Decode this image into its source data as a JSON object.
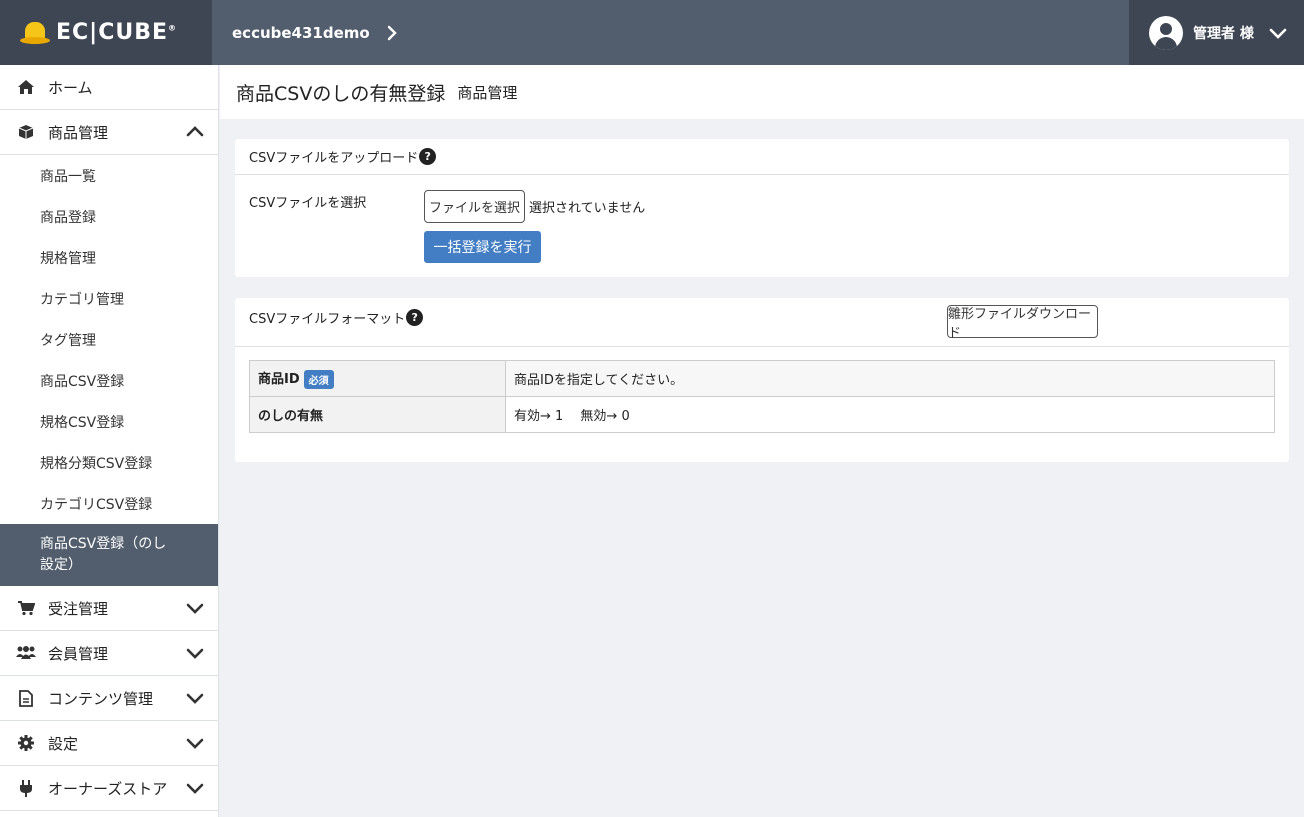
{
  "header": {
    "logo_text": "EC|CUBE",
    "logo_mark": "®",
    "shop_name": "eccube431demo",
    "user_name": "管理者 様"
  },
  "sidebar": {
    "home": "ホーム",
    "product": "商品管理",
    "product_items": [
      "商品一覧",
      "商品登録",
      "規格管理",
      "カテゴリ管理",
      "タグ管理",
      "商品CSV登録",
      "規格CSV登録",
      "規格分類CSV登録",
      "カテゴリCSV登録",
      "商品CSV登録（のし設定）"
    ],
    "order": "受注管理",
    "customer": "会員管理",
    "content": "コンテンツ管理",
    "setting": "設定",
    "owners_store": "オーナーズストア"
  },
  "page": {
    "title": "商品CSVのしの有無登録",
    "subtitle": "商品管理"
  },
  "upload": {
    "heading": "CSVファイルをアップロード",
    "help": "?",
    "select_label": "CSVファイルを選択",
    "file_button": "ファイルを選択",
    "file_status": "選択されていません",
    "exec_button": "一括登録を実行"
  },
  "format": {
    "heading": "CSVファイルフォーマット",
    "help": "?",
    "download_button": "雛形ファイルダウンロード",
    "rows": [
      {
        "key": "商品ID",
        "required": "必須",
        "desc": "商品IDを指定してください。"
      },
      {
        "key": "のしの有無",
        "required": "",
        "desc": "有効→ 1　 無効→ 0"
      }
    ]
  },
  "colors": {
    "header_bg": "#525e6d",
    "header_dark": "#3d4652",
    "accent": "#437ec4",
    "active_nav": "#525e6d"
  }
}
